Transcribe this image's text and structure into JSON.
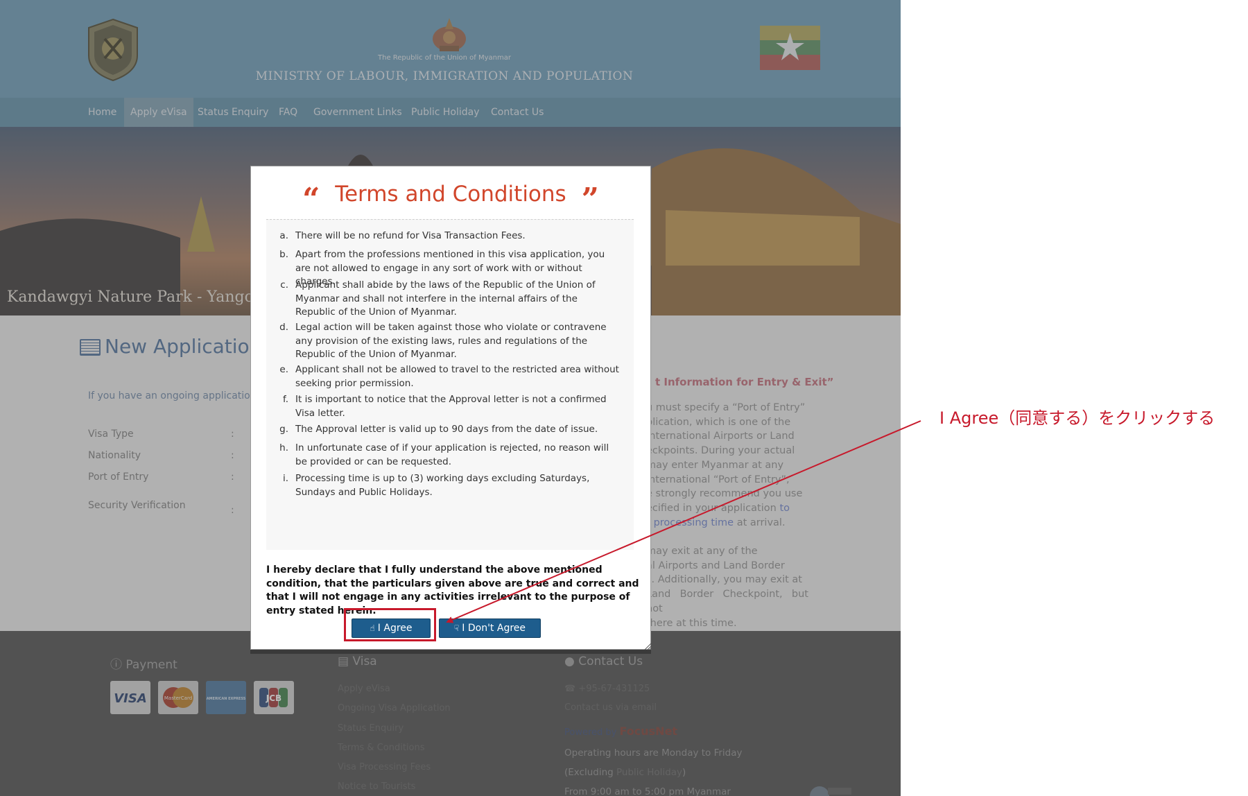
{
  "header": {
    "republic": "The Republic of the Union of Myanmar",
    "ministry": "MINISTRY OF  LABOUR, IMMIGRATION AND POPULATION"
  },
  "nav": {
    "items": [
      "Home",
      "Apply eVisa",
      "Status Enquiry",
      "FAQ",
      "Government Links",
      "Public Holiday",
      "Contact Us"
    ],
    "active": "Apply eVisa"
  },
  "banner": {
    "caption": "Kandawgyi Nature Park - Yangon"
  },
  "page": {
    "heading": "New Application",
    "ongoing_text": "If you have an ongoing applicatio",
    "fields": [
      "Visa Type",
      "Nationality",
      "Port of Entry",
      "Security Verification"
    ],
    "colon": ":",
    "right_title": "t Information for Entry & Exit”",
    "right_para1_lines": [
      "u must specify a “Port of Entry”",
      "plication, which is one of the",
      "International Airports or Land",
      "eckpoints. During your actual",
      "may enter Myanmar at any",
      "international “Port of Entry”,",
      "e strongly recommend you use",
      "ecified in your application"
    ],
    "right_link1": "to",
    "right_link2": "r processing time",
    "right_after_link": "at arrival.",
    "right_para2_lines": [
      "may exit at any of the",
      "al Airports and Land Border",
      "s. Additionally, you may exit at",
      "Land Border Checkpoint, but not",
      "there at this time."
    ]
  },
  "footer": {
    "payment_title": "Payment",
    "cards": [
      "VISA",
      "MasterCard",
      "AMERICAN EXPRESS",
      "JCB"
    ],
    "visa_title": "Visa",
    "visa_links": [
      "Apply eVisa",
      "Ongoing Visa Application",
      "Status Enquiry",
      "Terms & Conditions",
      "Visa Processing Fees",
      "Notice to Tourists"
    ],
    "contact_title": "Contact Us",
    "phone": "+95-67-431125",
    "email_link": "Contact us via email",
    "powered_by": "Powered by",
    "powered_brand": "FocusNet",
    "hours_line1": "Operating hours are Monday to Friday",
    "hours_line2_prefix": "(Excluding",
    "hours_line2_link": "Public Holiday",
    "hours_line2_suffix": ")",
    "hours_line3": "From 9:00 am to 5:00 pm Myanmar"
  },
  "modal": {
    "title": "Terms and Conditions",
    "open_quote": "“",
    "close_quote": "”",
    "terms": [
      {
        "letter": "a.",
        "text": "There will be no refund for Visa Transaction Fees."
      },
      {
        "letter": "b.",
        "text": "Apart from the professions mentioned in this visa application, you are not allowed to engage in any sort of work with or without charges."
      },
      {
        "letter": "c.",
        "text": "Applicant shall abide by the laws of the Republic of the Union of Myanmar and shall not interfere in the internal affairs of the Republic of the Union of Myanmar."
      },
      {
        "letter": "d.",
        "text": "Legal action will be taken against those who violate or contravene any provision of the existing laws, rules and regulations of the Republic of the Union of Myanmar."
      },
      {
        "letter": "e.",
        "text": "Applicant shall not be allowed to travel to the restricted area without seeking prior permission."
      },
      {
        "letter": "f.",
        "text": "It is important to notice that the Approval letter is not a confirmed Visa letter."
      },
      {
        "letter": "g.",
        "text": "The Approval letter is valid up to 90 days from the date of issue."
      },
      {
        "letter": "h.",
        "text": "In unfortunate case of if your application is rejected, no reason will be provided or can be requested."
      },
      {
        "letter": "i.",
        "text": "Processing time is up to (3) working days excluding Saturdays, Sundays and Public Holidays."
      }
    ],
    "declaration": "I hereby declare that I fully understand the above mentioned condition, that the particulars given above are true and correct and that I will not engage in any activities irrelevant to the purpose of entry stated herein.",
    "agree_label": "I Agree",
    "disagree_label": "I Don't Agree"
  },
  "annotation": {
    "text": "I Agree（同意する）をクリックする",
    "color": "#c7192b"
  }
}
